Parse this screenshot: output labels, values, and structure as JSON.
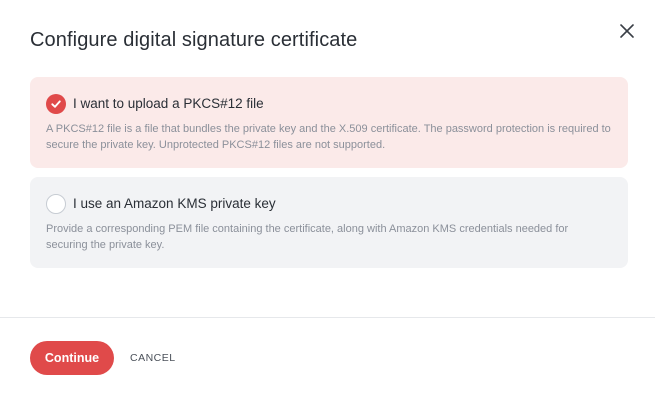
{
  "dialog": {
    "title": "Configure digital signature certificate",
    "close_icon": "close-icon"
  },
  "options": [
    {
      "label": "I want to upload a PKCS#12 file",
      "description": "A PKCS#12 file is a file that bundles the private key and the X.509 certificate. The password protection is required to secure the private key. Unprotected PKCS#12 files are not supported.",
      "selected": true
    },
    {
      "label": "I use an Amazon KMS private key",
      "description": "Provide a corresponding PEM file containing the certificate, along with Amazon KMS credentials needed for securing the private key.",
      "selected": false
    }
  ],
  "footer": {
    "continue_label": "Continue",
    "cancel_label": "CANCEL"
  },
  "colors": {
    "accent": "#e04a4a",
    "selected_bg": "#fbeae9",
    "unselected_bg": "#f2f3f5",
    "title_text": "#2a2f36",
    "muted_text": "#8b909a"
  }
}
